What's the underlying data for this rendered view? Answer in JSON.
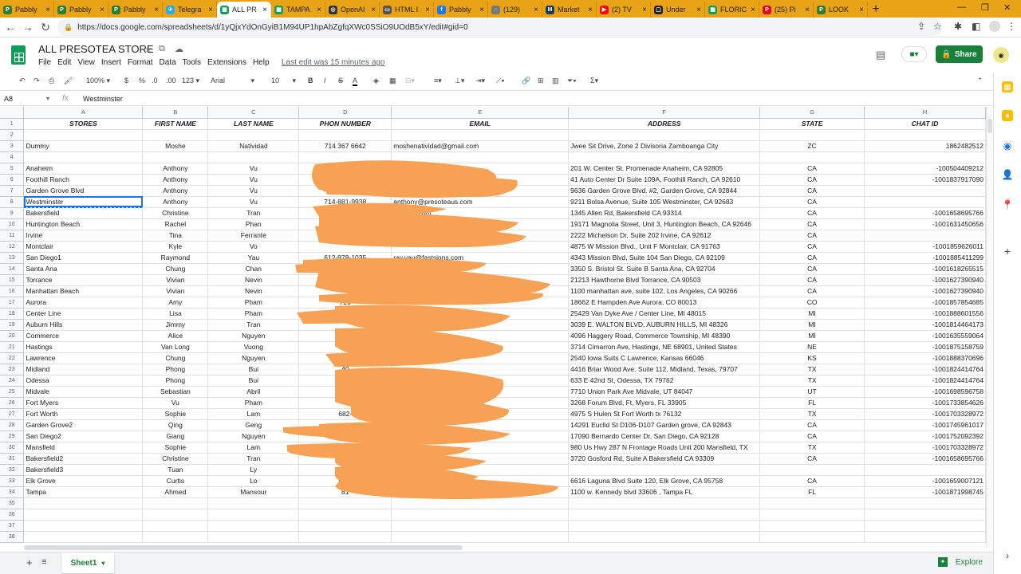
{
  "browser": {
    "tabs": [
      {
        "label": "Pabbly",
        "color": "#2e7d32",
        "glyph": "P"
      },
      {
        "label": "Pabbly",
        "color": "#2e7d32",
        "glyph": "P"
      },
      {
        "label": "Pabbly",
        "color": "#2e7d32",
        "glyph": "P"
      },
      {
        "label": "Telegra",
        "color": "#2aabee",
        "glyph": "✈"
      },
      {
        "label": "ALL PR",
        "color": "#0f9d58",
        "glyph": "▦",
        "active": true
      },
      {
        "label": "TAMPA",
        "color": "#0f9d58",
        "glyph": "▦"
      },
      {
        "label": "OpenAI",
        "color": "#333333",
        "glyph": "◎"
      },
      {
        "label": "HTML I",
        "color": "#555555",
        "glyph": "▭"
      },
      {
        "label": "Pabbly",
        "color": "#1877f2",
        "glyph": "f"
      },
      {
        "label": "(129)",
        "color": "#777777",
        "glyph": "◌"
      },
      {
        "label": "Market",
        "color": "#1a3a5c",
        "glyph": "M"
      },
      {
        "label": "(2) TV",
        "color": "#ff0000",
        "glyph": "▶"
      },
      {
        "label": "Under",
        "color": "#222222",
        "glyph": "▢"
      },
      {
        "label": "FLORIC",
        "color": "#0f9d58",
        "glyph": "▦"
      },
      {
        "label": "(25) Pi",
        "color": "#e60023",
        "glyph": "P"
      },
      {
        "label": "LOOK",
        "color": "#2e7d32",
        "glyph": "P"
      }
    ],
    "url": "https://docs.google.com/spreadsheets/d/1yQjxYdOnGyiB1M94UP1hpAbZgfqXWc0SSiO9UOdB5xY/edit#gid=0"
  },
  "app": {
    "title": "ALL PRESOTEA STORE",
    "menus": [
      "File",
      "Edit",
      "View",
      "Insert",
      "Format",
      "Data",
      "Tools",
      "Extensions",
      "Help"
    ],
    "last_edit": "Last edit was 15 minutes ago",
    "share": "Share",
    "toolbar": {
      "zoom": "100%",
      "currency": "$",
      "percent": "%",
      "dec_less": ".0",
      "dec_more": ".00",
      "format": "123",
      "font": "Arial",
      "size": "10"
    },
    "namebox": "A8",
    "formula": "Westminster",
    "sheet_tab": "Sheet1",
    "explore": "Explore",
    "accent": "#188038"
  },
  "columns": [
    "A",
    "B",
    "C",
    "D",
    "E",
    "F",
    "G",
    "H"
  ],
  "rows": [
    {
      "n": "1",
      "cells": [
        "STORES",
        "FIRST NAME",
        "LAST NAME",
        "PHON NUMBER",
        "EMAIL",
        "ADDRESS",
        "STATE",
        "CHAT ID"
      ],
      "hdr": true
    },
    {
      "n": "2",
      "cells": [
        "",
        "",
        "",
        "",
        "",
        "",
        "",
        ""
      ]
    },
    {
      "n": "3",
      "cells": [
        "Dummy",
        "Moshe",
        "Natividad",
        "714 367 6642",
        "moshenatividad@gmail.com",
        "Jwee Sit Drive, Zone 2 Divisoria Zamboanga City",
        "ZC",
        "1862482512"
      ]
    },
    {
      "n": "4",
      "cells": [
        "",
        "",
        "",
        "",
        "",
        "",
        "",
        ""
      ]
    },
    {
      "n": "5",
      "cells": [
        "Anaheim",
        "Anthony",
        "Vu",
        "",
        "",
        "201 W. Center St. Promenade      Anaheim, CA 92805",
        "CA",
        "-100504409212"
      ]
    },
    {
      "n": "6",
      "cells": [
        "Foothill Ranch",
        "Anthony",
        "Vu",
        "",
        "",
        "41 Auto Center Dr Suite 109A, Foothill Ranch, CA 92610",
        "CA",
        "-1001837917090"
      ]
    },
    {
      "n": "7",
      "cells": [
        "Garden Grove Blvd",
        "Anthony",
        "Vu",
        "",
        "",
        "9636 Garden Grove Blvd. #2, Garden Grove, CA 92844",
        "CA",
        ""
      ]
    },
    {
      "n": "8",
      "cells": [
        "Westminster",
        "Anthony",
        "Vu",
        "714-881-9938",
        "anthony@presoteaus.com",
        "9211 Bolsa Avenue, Suite 105 Westminster, CA 92683",
        "CA",
        ""
      ]
    },
    {
      "n": "9",
      "cells": [
        "Bakersfield",
        "Christine",
        "Tran",
        "",
        "@gmail.com",
        "1345 Allen Rd, Bakersfield CA 93314",
        "CA",
        "-1001658695766"
      ]
    },
    {
      "n": "10",
      "cells": [
        "Huntington Beach",
        "Rachel",
        "Phan",
        "",
        "",
        "19171 Magnolia Street, Unit 3, Huntington Beach, CA 92646",
        "CA",
        "-1001631450656"
      ]
    },
    {
      "n": "11",
      "cells": [
        "Irvine",
        "Tina",
        "Ferrante",
        "",
        "e@gmail.com",
        "2222 Michelson Dr, Suite 202 Irvine, CA 92612",
        "CA",
        ""
      ]
    },
    {
      "n": "12",
      "cells": [
        "Montclair",
        "Kyle",
        "Vo",
        "",
        "",
        "4875 W Mission Blvd., Unit F Montclair,  CA 91763",
        "CA",
        "-1001859626011"
      ]
    },
    {
      "n": "13",
      "cells": [
        "San Diego1",
        "Raymond",
        "Yau",
        "612-978-1035",
        "ray.yau@fastsigns.com",
        "4343 Mission Blvd, Suite 104 San Diego, CA 92109",
        "CA",
        "-1001885411299"
      ]
    },
    {
      "n": "14",
      "cells": [
        "Santa Ana",
        "Chung",
        "Chan",
        "",
        "",
        "3350 S. Bristol St. Suite B Santa Ana, CA 92704",
        "CA",
        "-1001618265515"
      ]
    },
    {
      "n": "15",
      "cells": [
        "Torrance",
        "Vivian",
        "Nevin",
        "",
        "",
        "21213 Hawthorne Blvd Torrance, CA 90503",
        "CA",
        "-1001627390940"
      ]
    },
    {
      "n": "16",
      "cells": [
        "Manhattan Beach",
        "Vivian",
        "Nevin",
        "",
        "",
        "1100 manhattan ave, suite 102, Los Angeles, CA 90266",
        "CA",
        "-1001627390940"
      ]
    },
    {
      "n": "17",
      "cells": [
        "Aurora",
        "Amy",
        "Pham",
        "720",
        "",
        "18662 E Hampden Ave Aurora, CO 80013",
        "CO",
        "-1001857854685"
      ]
    },
    {
      "n": "18",
      "cells": [
        "Center Line",
        "Lisa",
        "Pham",
        "",
        "",
        "25429 Van Dyke Ave / Center Line, MI 48015",
        "MI",
        "-1001888601556"
      ]
    },
    {
      "n": "19",
      "cells": [
        "Auburn Hills",
        "Jimmy",
        "Tran",
        "",
        "@gmail.com",
        "3039 E. WALTON BLVD, AUBURN HILLS, MI  48326",
        "MI",
        "-1001814464173"
      ]
    },
    {
      "n": "20",
      "cells": [
        "Commerce",
        "Alice",
        "Nguyen",
        "",
        "",
        "4096 Haggery Road, Commerce Township, MI 48390",
        "MI",
        "-1001635559064"
      ]
    },
    {
      "n": "21",
      "cells": [
        "Hastings",
        "Van Long",
        "Vuong",
        "",
        "",
        "3714 Cimarron Ave, Hastings, NE 68901, United States",
        "NE",
        "-1001875158759"
      ]
    },
    {
      "n": "22",
      "cells": [
        "Lawrence",
        "Chung",
        "Nguyen",
        "785-",
        "ail.com",
        "2540 Iowa Suits C Lawrence, Kansas 66046",
        "KS",
        "-1001888370696"
      ]
    },
    {
      "n": "23",
      "cells": [
        "Midland",
        "Phong",
        "Bui",
        "40",
        "",
        "4416 Briar Wood Ave. Suite 112, Midland, Texas, 79707",
        "TX",
        "-1001824414764"
      ]
    },
    {
      "n": "24",
      "cells": [
        "Odessa",
        "Phong",
        "Bui",
        "402-",
        "",
        "633 E 42nd St, Odessa, TX 79762",
        "TX",
        "-1001824414764"
      ]
    },
    {
      "n": "25",
      "cells": [
        "Midvale",
        "Sebastian",
        "Abril",
        "",
        "",
        "7710 Union Park Ave Midvale, UT 84047",
        "UT",
        "-1001698596758"
      ]
    },
    {
      "n": "26",
      "cells": [
        "Fort Myers",
        "Vu",
        "Pham",
        "",
        "",
        "3268 Forum Blvd, Ft, Myers, FL 33905",
        "FL",
        "-1001733854626"
      ]
    },
    {
      "n": "27",
      "cells": [
        "Fort Worth",
        "Sophie",
        "Lam",
        "682-",
        "",
        "4975 S Hulen St Fort Worth tx 76132",
        "TX",
        "-1001703328972"
      ]
    },
    {
      "n": "28",
      "cells": [
        "Garden Grove2",
        "Qing",
        "Geng",
        "",
        "",
        "14291 Euclid St D106-D107 Garden grove, CA 92843",
        "CA",
        "-1001745961017"
      ]
    },
    {
      "n": "29",
      "cells": [
        "San Diego2",
        "Giang",
        "Nguyen",
        "",
        "oo.com",
        "17090 Bernardo Center Dr, San Diego, CA 92128",
        "CA",
        "-1001752092392"
      ]
    },
    {
      "n": "30",
      "cells": [
        "Mansfield",
        "Sophie",
        "Lam",
        "",
        "",
        "980 Us Hwy 287 N Frontage Roads Unit 200 Mansfield, TX",
        "TX",
        "-1001703328972"
      ]
    },
    {
      "n": "31",
      "cells": [
        "Bakersfield2",
        "Christine",
        "Tran",
        "",
        "",
        "3720 Gosford Rd, Suite A Bakersfield CA 93309",
        "CA",
        "-1001658695766"
      ]
    },
    {
      "n": "32",
      "cells": [
        "Bakersfield3",
        "Tuan",
        "Ly",
        "",
        "",
        "",
        "",
        ""
      ]
    },
    {
      "n": "33",
      "cells": [
        "Elk Grove",
        "Curtis",
        "Lo",
        "916-",
        "@gmail.com",
        "6616 Laguna Blvd Suite 120, Elk Grove, CA 95758",
        "CA",
        "-1001659007121"
      ]
    },
    {
      "n": "34",
      "cells": [
        "Tampa",
        "Ahmed",
        "Mansour",
        "81",
        "nail",
        "1100 w. Kennedy blvd 33606 , Tampa FL",
        "FL",
        "-1001871998745"
      ]
    },
    {
      "n": "35",
      "cells": [
        "",
        "",
        "",
        "",
        "",
        "",
        "",
        ""
      ]
    },
    {
      "n": "36",
      "cells": [
        "",
        "",
        "",
        "",
        "",
        "",
        "",
        ""
      ]
    },
    {
      "n": "37",
      "cells": [
        "",
        "",
        "",
        "",
        "",
        "",
        "",
        ""
      ]
    },
    {
      "n": "38",
      "cells": [
        "",
        "",
        "",
        "",
        "",
        "",
        "",
        ""
      ]
    }
  ]
}
